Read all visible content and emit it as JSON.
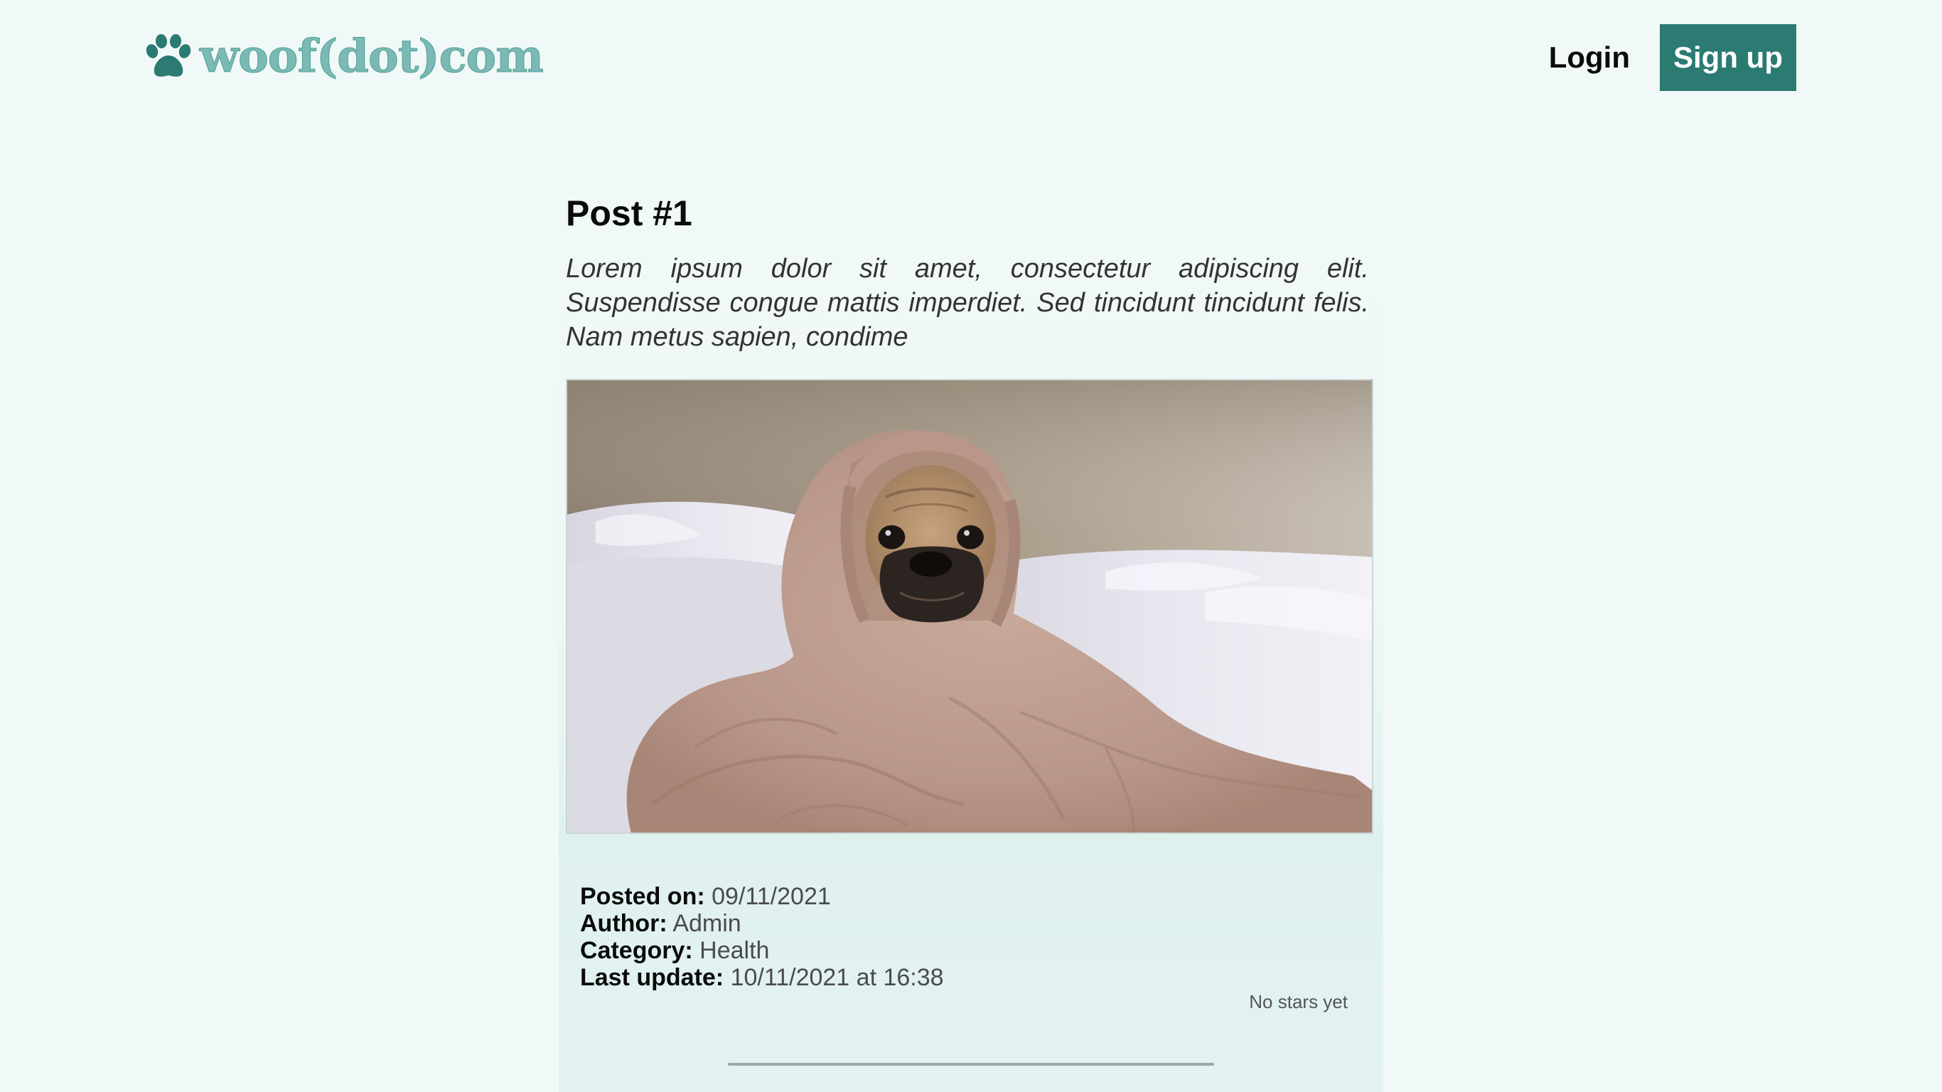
{
  "brand": {
    "name": "woof(dot)com",
    "icon": "paw-icon",
    "color": "#2b7b72"
  },
  "nav": {
    "login_label": "Login",
    "signup_label": "Sign up"
  },
  "post": {
    "title": "Post #1",
    "excerpt": "Lorem ipsum dolor sit amet, consectetur adipiscing elit. Suspendisse congue mattis imperdiet. Sed tincidunt tincidunt felis. Nam metus sapien, condime",
    "meta": {
      "posted_on_label": "Posted on:",
      "posted_on_value": "09/11/2021",
      "author_label": "Author:",
      "author_value": "Admin",
      "category_label": "Category:",
      "category_value": "Health",
      "last_update_label": "Last update:",
      "last_update_value": "10/11/2021 at 16:38"
    },
    "rating_text": "No stars yet"
  },
  "colors": {
    "background": "#f1f9f8",
    "accent": "#2b7b72"
  }
}
